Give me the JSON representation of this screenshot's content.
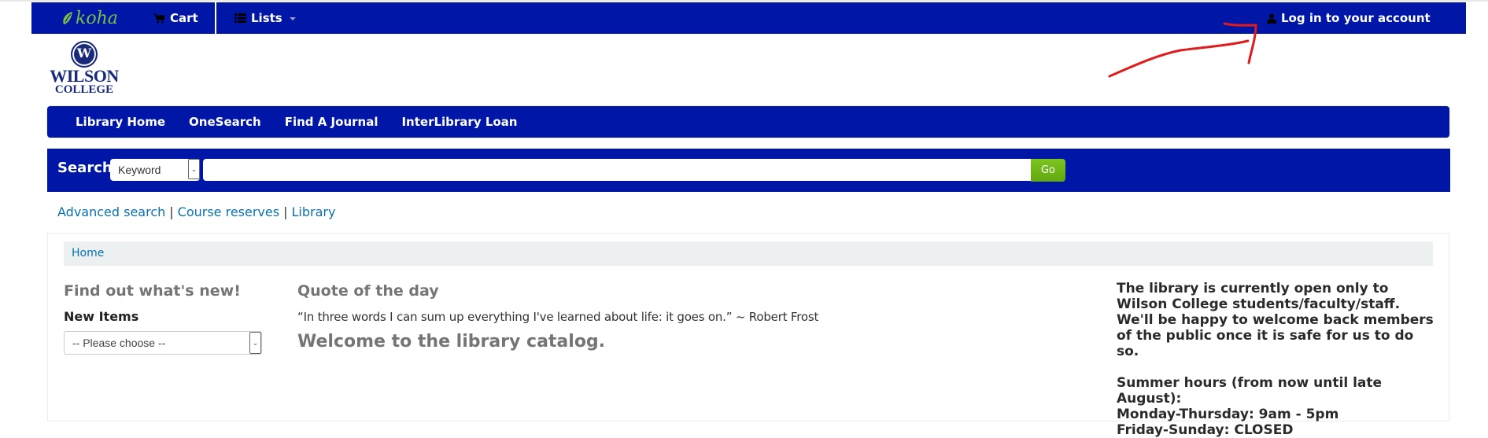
{
  "topbar": {
    "logo_text": "koha",
    "cart_label": "Cart",
    "lists_label": "Lists",
    "login_label": "Log in to your account"
  },
  "logo": {
    "initial": "W",
    "name": "WILSON",
    "sub": "COLLEGE"
  },
  "navbar": {
    "links": [
      {
        "label": "Library Home"
      },
      {
        "label": "OneSearch"
      },
      {
        "label": "Find A Journal"
      },
      {
        "label": "InterLibrary Loan"
      }
    ]
  },
  "search": {
    "label": "Search",
    "type_selected": "Keyword",
    "query_value": "",
    "go_label": "Go"
  },
  "more_links": {
    "advanced": "Advanced search",
    "course": "Course reserves",
    "library": "Library",
    "separator": "|"
  },
  "breadcrumb": {
    "home": "Home"
  },
  "whats_new": {
    "heading": "Find out what's new!",
    "label": "New Items",
    "selected": "-- Please choose --"
  },
  "quote": {
    "heading": "Quote of the day",
    "text": "“In three words I can sum up everything I've learned about life: it goes on.” ~ Robert Frost"
  },
  "welcome": {
    "heading": "Welcome to the library catalog."
  },
  "notice": {
    "paragraph": "The library is currently open only to Wilson College students/faculty/staff. We'll be happy to welcome back members of the public once it is safe for us to do so.",
    "hours_title": "Summer hours (from now until late August):",
    "hours_weekday": "Monday-Thursday: 9am - 5pm",
    "hours_weekend": "Friday-Sunday: CLOSED"
  },
  "colors": {
    "brand_blue": "#0016a6",
    "go_green": "#6cb613",
    "koha_green": "#7ac143",
    "link_blue": "#0a70b0",
    "annotation_red": "#e01b1b"
  }
}
